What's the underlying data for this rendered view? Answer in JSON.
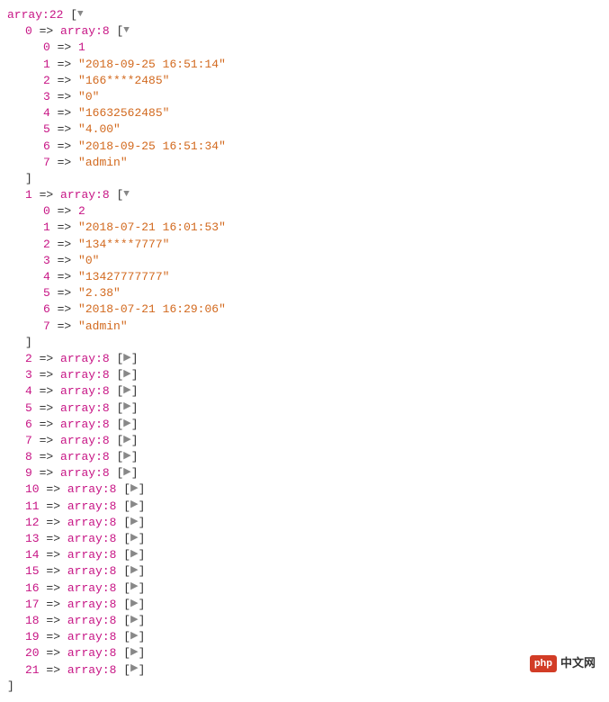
{
  "root": {
    "type": "array",
    "count": 22
  },
  "expanded": [
    {
      "index": 0,
      "type": "array",
      "count": 8,
      "items": [
        {
          "k": 0,
          "kind": "num",
          "v": "1"
        },
        {
          "k": 1,
          "kind": "str",
          "v": "2018-09-25 16:51:14"
        },
        {
          "k": 2,
          "kind": "str",
          "v": "166****2485"
        },
        {
          "k": 3,
          "kind": "str",
          "v": "0"
        },
        {
          "k": 4,
          "kind": "str",
          "v": "16632562485"
        },
        {
          "k": 5,
          "kind": "str",
          "v": "4.00"
        },
        {
          "k": 6,
          "kind": "str",
          "v": "2018-09-25 16:51:34"
        },
        {
          "k": 7,
          "kind": "str",
          "v": "admin"
        }
      ]
    },
    {
      "index": 1,
      "type": "array",
      "count": 8,
      "items": [
        {
          "k": 0,
          "kind": "num",
          "v": "2"
        },
        {
          "k": 1,
          "kind": "str",
          "v": "2018-07-21 16:01:53"
        },
        {
          "k": 2,
          "kind": "str",
          "v": "134****7777"
        },
        {
          "k": 3,
          "kind": "str",
          "v": "0"
        },
        {
          "k": 4,
          "kind": "str",
          "v": "13427777777"
        },
        {
          "k": 5,
          "kind": "str",
          "v": "2.38"
        },
        {
          "k": 6,
          "kind": "str",
          "v": "2018-07-21 16:29:06"
        },
        {
          "k": 7,
          "kind": "str",
          "v": "admin"
        }
      ]
    }
  ],
  "collapsed": [
    {
      "index": 2,
      "type": "array",
      "count": 8
    },
    {
      "index": 3,
      "type": "array",
      "count": 8
    },
    {
      "index": 4,
      "type": "array",
      "count": 8
    },
    {
      "index": 5,
      "type": "array",
      "count": 8
    },
    {
      "index": 6,
      "type": "array",
      "count": 8
    },
    {
      "index": 7,
      "type": "array",
      "count": 8
    },
    {
      "index": 8,
      "type": "array",
      "count": 8
    },
    {
      "index": 9,
      "type": "array",
      "count": 8
    },
    {
      "index": 10,
      "type": "array",
      "count": 8
    },
    {
      "index": 11,
      "type": "array",
      "count": 8
    },
    {
      "index": 12,
      "type": "array",
      "count": 8
    },
    {
      "index": 13,
      "type": "array",
      "count": 8
    },
    {
      "index": 14,
      "type": "array",
      "count": 8
    },
    {
      "index": 15,
      "type": "array",
      "count": 8
    },
    {
      "index": 16,
      "type": "array",
      "count": 8
    },
    {
      "index": 17,
      "type": "array",
      "count": 8
    },
    {
      "index": 18,
      "type": "array",
      "count": 8
    },
    {
      "index": 19,
      "type": "array",
      "count": 8
    },
    {
      "index": 20,
      "type": "array",
      "count": 8
    },
    {
      "index": 21,
      "type": "array",
      "count": 8
    }
  ],
  "symbols": {
    "arrow": "=>",
    "open_bracket": "[",
    "close_bracket": "]",
    "colon": ":",
    "tri_down": "▼",
    "tri_right": "▶",
    "dq": "\""
  },
  "watermark": {
    "badge": "php",
    "text": "中文网"
  }
}
